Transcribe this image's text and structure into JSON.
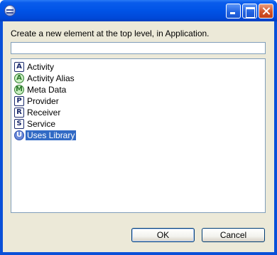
{
  "window": {
    "title": ""
  },
  "dialog": {
    "prompt": "Create a new element at the top level, in Application.",
    "filter": {
      "value": "",
      "placeholder": ""
    },
    "items": [
      {
        "label": "Activity",
        "icon": "activity-icon",
        "glyph": "A",
        "selected": false
      },
      {
        "label": "Activity Alias",
        "icon": "activity-alias-icon",
        "glyph": "A",
        "selected": false
      },
      {
        "label": "Meta Data",
        "icon": "meta-data-icon",
        "glyph": "M",
        "selected": false
      },
      {
        "label": "Provider",
        "icon": "provider-icon",
        "glyph": "P",
        "selected": false
      },
      {
        "label": "Receiver",
        "icon": "receiver-icon",
        "glyph": "R",
        "selected": false
      },
      {
        "label": "Service",
        "icon": "service-icon",
        "glyph": "S",
        "selected": false
      },
      {
        "label": "Uses Library",
        "icon": "uses-library-icon",
        "glyph": "U",
        "selected": true
      }
    ],
    "ok_label": "OK",
    "cancel_label": "Cancel"
  },
  "colors": {
    "selection": "#316ac5",
    "titlebar": "#0053e6",
    "dialog_bg": "#ece9d8"
  }
}
